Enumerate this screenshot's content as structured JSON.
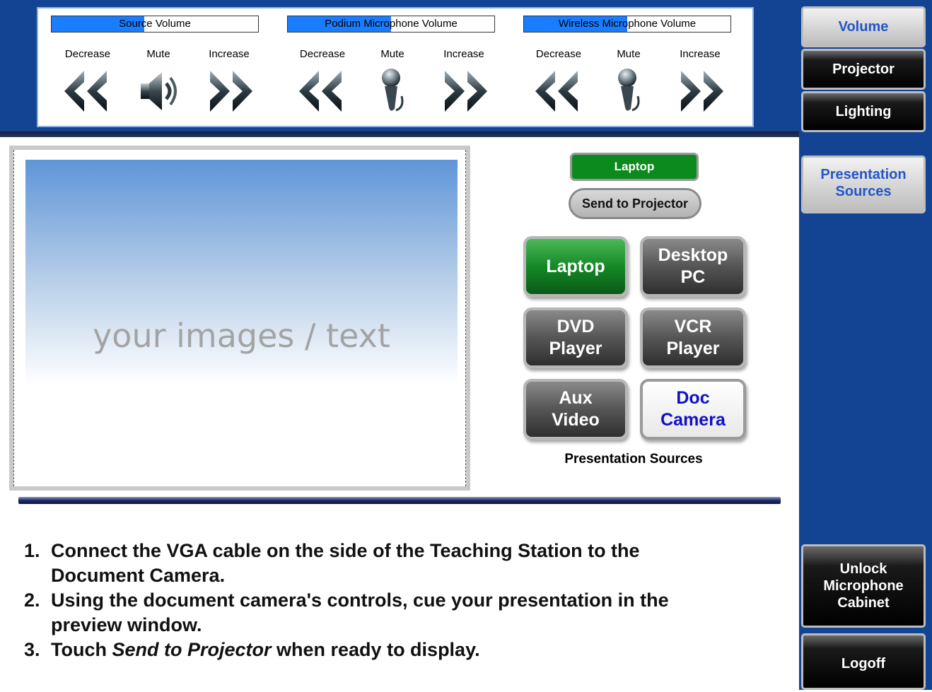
{
  "volume": [
    {
      "title": "Source Volume",
      "level": 0.45,
      "decrease": "Decrease",
      "mute": "Mute",
      "increase": "Increase",
      "mute_icon": "speaker-icon"
    },
    {
      "title": "Podium Microphone Volume",
      "level": 0.5,
      "decrease": "Decrease",
      "mute": "Mute",
      "increase": "Increase",
      "mute_icon": "microphone-icon"
    },
    {
      "title": "Wireless Microphone Volume",
      "level": 0.5,
      "decrease": "Decrease",
      "mute": "Mute",
      "increase": "Increase",
      "mute_icon": "microphone-icon"
    }
  ],
  "preview": {
    "placeholder": "your images / text"
  },
  "status": {
    "current_source": "Laptop",
    "current_color": "#0c8a1e"
  },
  "send_button": "Send to Projector",
  "sources": {
    "buttons": [
      {
        "label": "Laptop",
        "style": "green"
      },
      {
        "label": "Desktop PC",
        "style": "gray"
      },
      {
        "label": "DVD Player",
        "style": "gray"
      },
      {
        "label": "VCR Player",
        "style": "gray"
      },
      {
        "label": "Aux Video",
        "style": "gray"
      },
      {
        "label": "Doc Camera",
        "style": "white"
      }
    ],
    "caption": "Presentation Sources"
  },
  "instructions": [
    {
      "num": "1.",
      "line1": "Connect the VGA cable on the side of the Teaching Station to the",
      "line2": "Document Camera."
    },
    {
      "num": "2.",
      "line1": "Using the document camera's controls, cue your presentation in the",
      "line2": "preview window."
    },
    {
      "num": "3.",
      "pre": "Touch ",
      "emph": "Send to Projector",
      "post": " when ready to display."
    }
  ],
  "sidebar": {
    "volume": "Volume",
    "projector": "Projector",
    "lighting": "Lighting",
    "presentation_sources": "Presentation Sources",
    "unlock": "Unlock Microphone Cabinet",
    "logoff": "Logoff"
  },
  "colors": {
    "brand_blue": "#134494",
    "accent_blue": "#1a7cff",
    "active_green": "#0c8a1e"
  }
}
